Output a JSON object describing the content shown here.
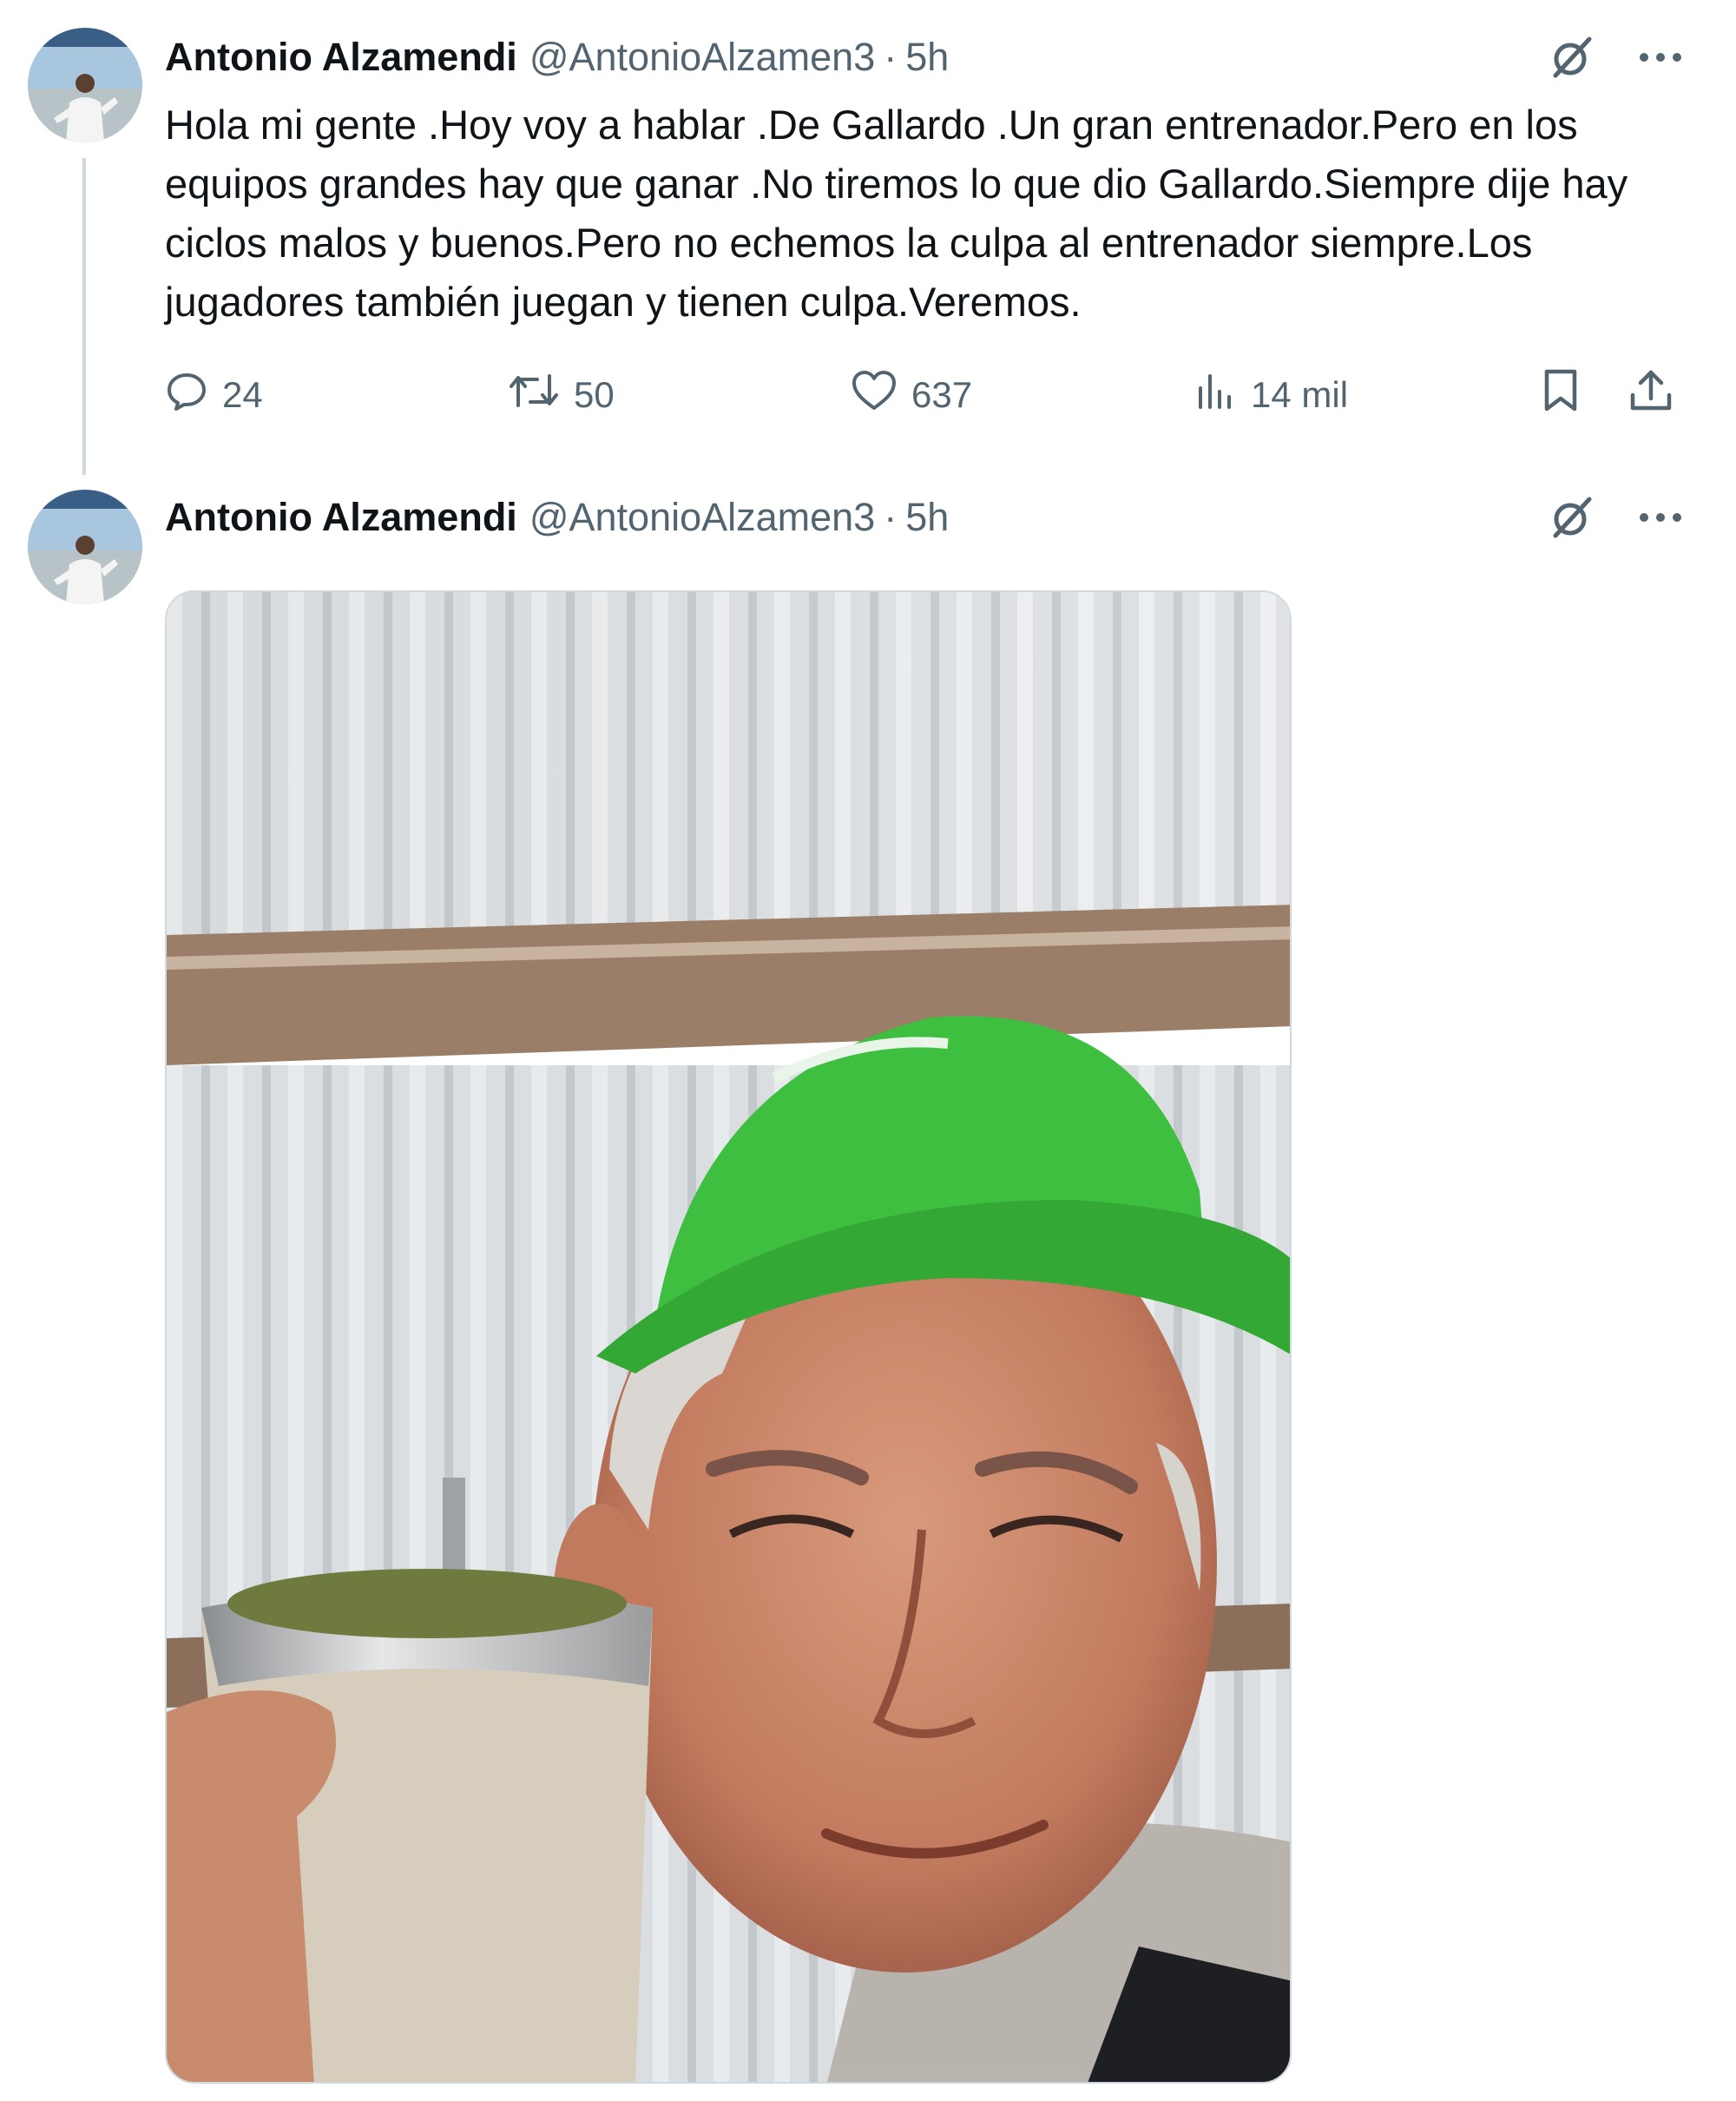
{
  "tweets": [
    {
      "author": {
        "display_name": "Antonio Alzamendi",
        "handle": "@AntonioAlzamen3",
        "separator": "·",
        "time": "5h"
      },
      "text": "Hola mi gente .Hoy voy a hablar .De Gallardo .Un gran entrenador.Pero en los equipos grandes hay que ganar .No tiremos lo que dio Gallardo.Siempre dije hay ciclos malos y buenos.Pero no echemos la culpa al entrenador siempre.Los jugadores también juegan  y tienen culpa.Veremos.",
      "actions": {
        "replies": "24",
        "reposts": "50",
        "likes": "637",
        "views": "14 mil"
      }
    },
    {
      "author": {
        "display_name": "Antonio Alzamendi",
        "handle": "@AntonioAlzamen3",
        "separator": "·",
        "time": "5h"
      },
      "media": {
        "icon": "photo-selfie"
      }
    }
  ],
  "colors": {
    "text_primary": "#0f1419",
    "text_secondary": "#536471",
    "thread_line": "#cfd9de",
    "background": "#ffffff",
    "cap_green": "#3fbf3f"
  }
}
